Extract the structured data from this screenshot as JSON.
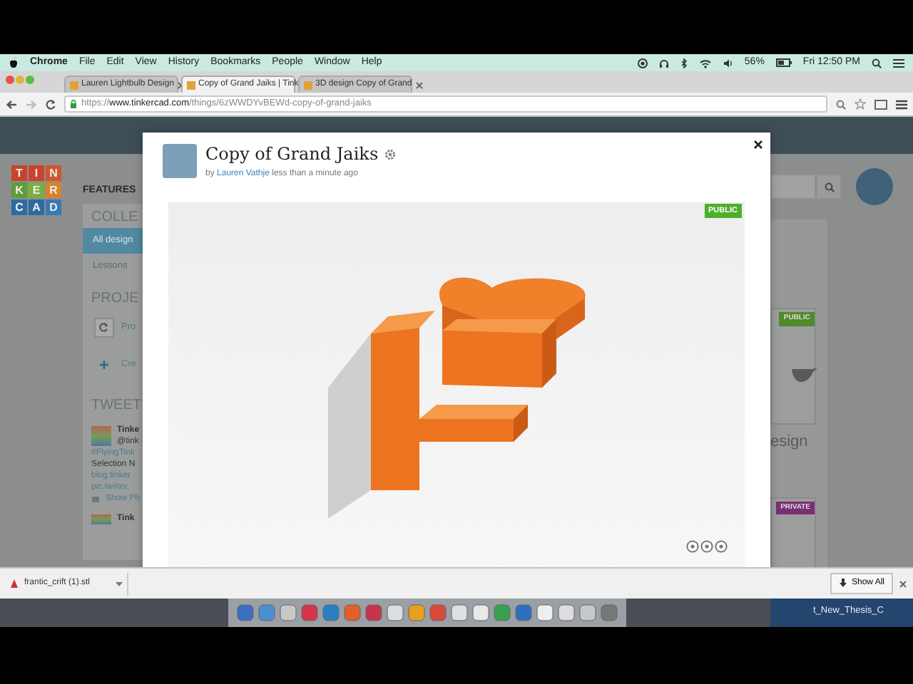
{
  "menubar": {
    "app": "Chrome",
    "items": [
      "File",
      "Edit",
      "View",
      "History",
      "Bookmarks",
      "People",
      "Window",
      "Help"
    ],
    "battery": "56%",
    "clock": "Fri 12:50 PM"
  },
  "tabs": [
    {
      "label": "Lauren Lightbulb Design",
      "selected": false
    },
    {
      "label": "Copy of Grand Jaiks | Tink",
      "selected": true
    },
    {
      "label": "3D design Copy of Grand",
      "selected": false
    }
  ],
  "address": {
    "scheme": "https://",
    "host": "www.tinkercad.com",
    "path": "/things/6zWWDYvBEWd-copy-of-grand-jaiks"
  },
  "logo": [
    {
      "letter": "T",
      "color": "#c9442f"
    },
    {
      "letter": "I",
      "color": "#c9442f"
    },
    {
      "letter": "N",
      "color": "#d0562c"
    },
    {
      "letter": "K",
      "color": "#5c9e3a"
    },
    {
      "letter": "E",
      "color": "#7aae3e"
    },
    {
      "letter": "R",
      "color": "#d9822a"
    },
    {
      "letter": "C",
      "color": "#2f6aa3"
    },
    {
      "letter": "A",
      "color": "#2f6aa3"
    },
    {
      "letter": "D",
      "color": "#3a7ab3"
    }
  ],
  "nav": [
    "FEATURES"
  ],
  "collections": {
    "heading": "COLLE",
    "items": [
      {
        "label": "All design",
        "selected": true
      },
      {
        "label": "Lessons",
        "selected": false
      }
    ]
  },
  "projects": {
    "heading": "PROJE",
    "items": [
      {
        "kind": "refresh",
        "label": "Pro"
      },
      {
        "kind": "create",
        "label": "Cre"
      }
    ]
  },
  "tweets": {
    "heading": "TWEET",
    "items": [
      {
        "name": "Tinke",
        "handle": "@tink",
        "lines": [
          "#FlyingTink",
          "Selection N",
          "blog.tinker",
          "pic.twitter."
        ],
        "action": "Show Ph"
      },
      {
        "name": "Tink"
      }
    ]
  },
  "cards": [
    {
      "kind": "public",
      "badge": "PUBLIC",
      "title": "esign"
    },
    {
      "kind": "private",
      "badge": "PRIVATE"
    }
  ],
  "modal": {
    "title": "Copy of Grand Jaiks",
    "byline": "by",
    "author": "Lauren Vathje",
    "time": "less than a minute ago",
    "badge": "PUBLIC"
  },
  "downloads": {
    "items": [
      {
        "filename": "frantic_crift (1).stl"
      }
    ],
    "show_all": "Show All"
  },
  "desktop": {
    "file": "t_New_Thesis_C"
  }
}
